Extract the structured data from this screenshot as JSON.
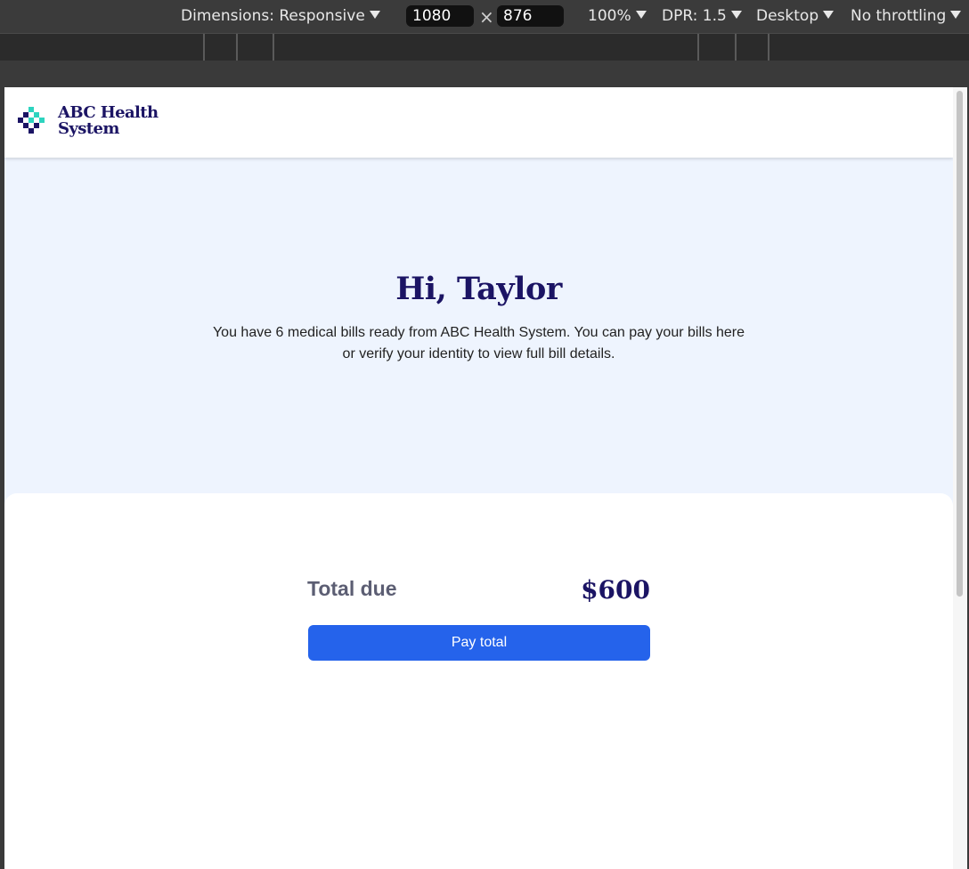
{
  "devtools": {
    "dimensions_label": "Dimensions: Responsive",
    "width_value": "1080",
    "times": "×",
    "height_value": "876",
    "zoom": "100%",
    "dpr": "DPR: 1.5",
    "device_type": "Desktop",
    "throttling": "No throttling"
  },
  "site": {
    "logo_line1": "ABC Health",
    "logo_line2": "System",
    "brand_colors": {
      "navy": "#1b1464",
      "teal": "#2dd4bf",
      "blue": "#2563eb"
    }
  },
  "hero": {
    "greeting": "Hi, Taylor",
    "message": "You have 6 medical bills ready from ABC Health System. You can pay your bills here or verify your identity to view full bill details."
  },
  "payment": {
    "total_label": "Total due",
    "total_amount": "$600",
    "pay_button_label": "Pay total"
  }
}
